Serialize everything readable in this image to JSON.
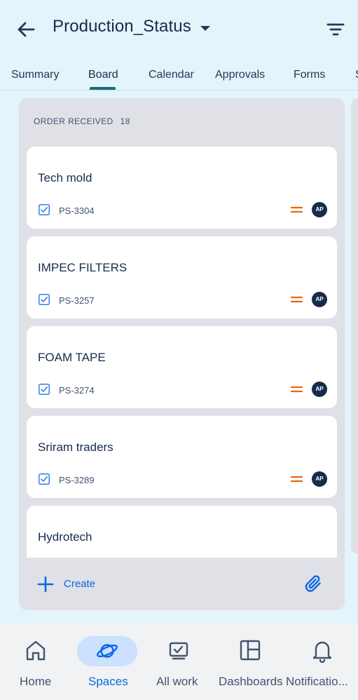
{
  "header": {
    "title": "Production_Status",
    "back_icon": "arrow-left-icon",
    "dropdown_icon": "caret-down-icon",
    "filter_icon": "filter-icon"
  },
  "tabs": [
    {
      "label": "Summary",
      "active": false
    },
    {
      "label": "Board",
      "active": true
    },
    {
      "label": "Calendar",
      "active": false
    },
    {
      "label": "Approvals",
      "active": false
    },
    {
      "label": "Forms",
      "active": false
    },
    {
      "label": "S",
      "active": false
    }
  ],
  "column": {
    "name": "ORDER RECEIVED",
    "count": "18",
    "cards": [
      {
        "title": "Tech mold",
        "key": "PS-3304",
        "assignee": "AP"
      },
      {
        "title": "IMPEC FILTERS",
        "key": "PS-3257",
        "assignee": "AP"
      },
      {
        "title": "FOAM TAPE",
        "key": "PS-3274",
        "assignee": "AP"
      },
      {
        "title": "Sriram traders",
        "key": "PS-3289",
        "assignee": "AP"
      },
      {
        "title": "Hydrotech"
      }
    ],
    "create_label": "Create"
  },
  "colors": {
    "background": "#e3f4fb",
    "accent": "#0c66e4",
    "priority_medium": "#e56910",
    "avatar": "#172b4d",
    "tab_underline": "#1b6b78"
  },
  "bottom_nav": [
    {
      "label": "Home",
      "icon": "home-icon",
      "active": false
    },
    {
      "label": "Spaces",
      "icon": "planet-icon",
      "active": true
    },
    {
      "label": "All work",
      "icon": "all-work-icon",
      "active": false
    },
    {
      "label": "Dashboards",
      "icon": "dashboard-icon",
      "active": false
    },
    {
      "label": "Notificatio...",
      "icon": "bell-icon",
      "active": false
    }
  ]
}
